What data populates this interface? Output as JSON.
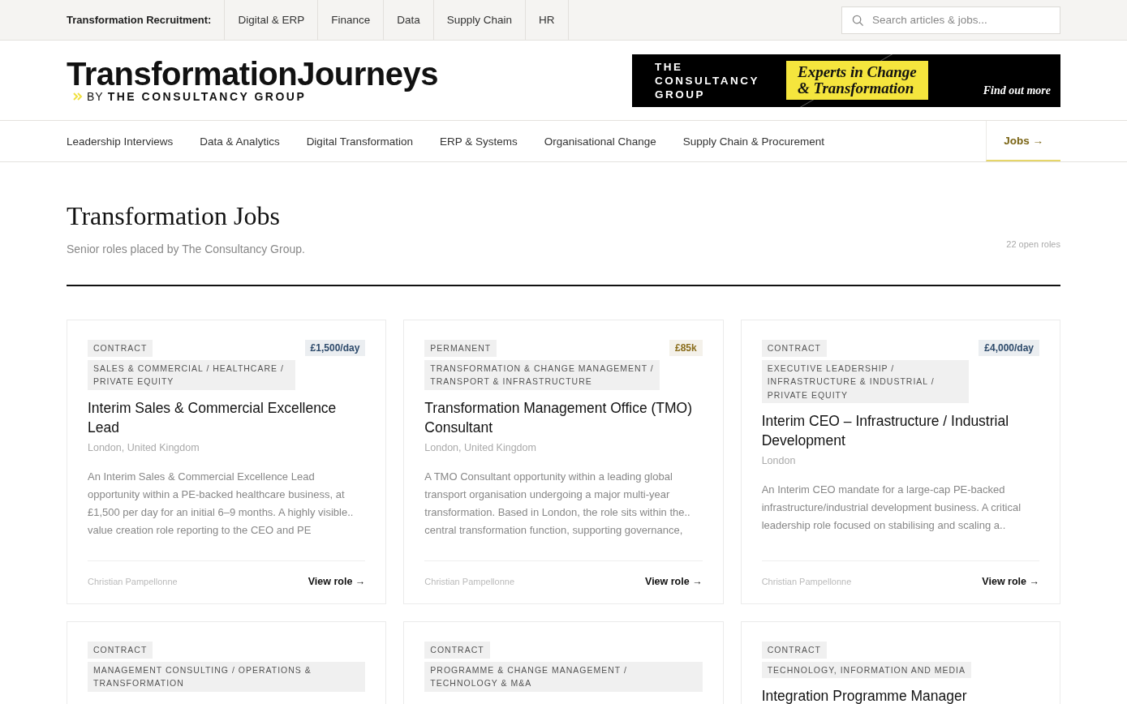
{
  "top_bar": {
    "label": "Transformation Recruitment:",
    "links": [
      "Digital & ERP",
      "Finance",
      "Data",
      "Supply Chain",
      "HR"
    ],
    "search": {
      "placeholder": "Search articles & jobs..."
    }
  },
  "header": {
    "logo": {
      "title": "TransformationJourneys",
      "by": "BY",
      "company": "THE CONSULTANCY GROUP"
    },
    "banner": {
      "brand": "THE CONSULTANCY GROUP",
      "headline_1": "Experts in Change",
      "headline_2": "& Transformation",
      "cta": "Find out more"
    }
  },
  "nav": [
    {
      "label": "Leadership Interviews",
      "selected": false
    },
    {
      "label": "Data & Analytics",
      "selected": false
    },
    {
      "label": "Digital Transformation",
      "selected": false
    },
    {
      "label": "ERP & Systems",
      "selected": false
    },
    {
      "label": "Organisational Change",
      "selected": false
    },
    {
      "label": "Supply Chain & Procurement",
      "selected": false
    },
    {
      "label": "Jobs →",
      "selected": true
    }
  ],
  "page": {
    "title": "Transformation Jobs",
    "subtitle": "Senior roles placed by The Consultancy Group.",
    "count": "22 open roles"
  },
  "jobs": [
    {
      "type": "CONTRACT",
      "sector": "SALES & COMMERCIAL / HEALTHCARE / PRIVATE EQUITY",
      "salary": {
        "text": "£1,500/day",
        "color": "#2d4a6b"
      },
      "title": "Interim Sales & Commercial Excellence Lead",
      "location": "London, United Kingdom",
      "description": "An Interim Sales & Commercial Excellence Lead opportunity within a PE-backed healthcare business, at £1,500 per day for an initial 6–9 months. A highly visible.. value creation role reporting to the CEO and PE",
      "recruiter": "Christian Pampellonne",
      "link": "View role →"
    },
    {
      "type": "PERMANENT",
      "sector": "TRANSFORMATION & CHANGE MANAGEMENT / TRANSPORT & INFRASTRUCTURE",
      "salary": {
        "text": "£85k",
        "color": "#8a6d1c"
      },
      "title": "Transformation Management Office (TMO) Consultant",
      "location": "London, United Kingdom",
      "description": "A TMO Consultant opportunity within a leading global transport organisation undergoing a major multi-year transformation. Based in London, the role sits within the.. central transformation function, supporting governance,",
      "recruiter": "Christian Pampellonne",
      "link": "View role →"
    },
    {
      "type": "CONTRACT",
      "sector": "EXECUTIVE LEADERSHIP / INFRASTRUCTURE & INDUSTRIAL / PRIVATE EQUITY",
      "salary": {
        "text": "£4,000/day",
        "color": "#2d4a6b"
      },
      "title": "Interim CEO – Infrastructure / Industrial Development",
      "location": "London",
      "description": "An Interim CEO mandate for a large-cap PE-backed infrastructure/industrial development business. A critical leadership role focused on stabilising and scaling a..",
      "recruiter": "Christian Pampellonne",
      "link": "View role →"
    },
    {
      "type": "CONTRACT",
      "sector": "MANAGEMENT CONSULTING / OPERATIONS & TRANSFORMATION"
    },
    {
      "type": "CONTRACT",
      "sector": "PROGRAMME & CHANGE MANAGEMENT / TECHNOLOGY & M&A"
    },
    {
      "type": "CONTRACT",
      "sector": "TECHNOLOGY, INFORMATION AND MEDIA",
      "title": "Integration Programme Manager"
    }
  ]
}
